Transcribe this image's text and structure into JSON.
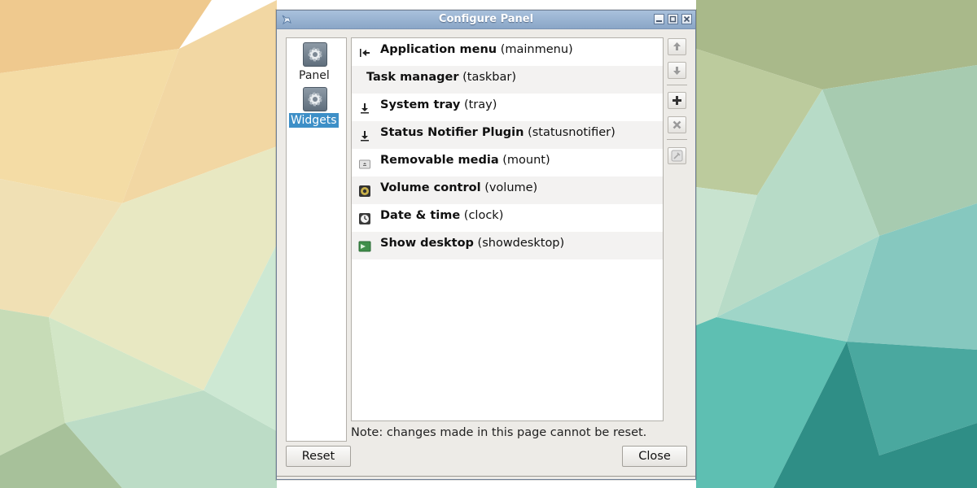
{
  "window": {
    "title": "Configure Panel",
    "controls": [
      "minimize-icon",
      "maximize-icon",
      "close-icon"
    ]
  },
  "sidebar": {
    "items": [
      {
        "label": "Panel",
        "icon": "panel-settings-icon",
        "selected": false
      },
      {
        "label": "Widgets",
        "icon": "widgets-settings-icon",
        "selected": true
      }
    ]
  },
  "widgets": [
    {
      "name": "Application menu",
      "id": "(mainmenu)",
      "icon": "app-menu-icon"
    },
    {
      "name": "Task manager",
      "id": "(taskbar)",
      "icon": ""
    },
    {
      "name": "System tray",
      "id": "(tray)",
      "icon": "download-arrow-icon"
    },
    {
      "name": "Status Notifier Plugin",
      "id": "(statusnotifier)",
      "icon": "download-arrow-icon"
    },
    {
      "name": "Removable media",
      "id": "(mount)",
      "icon": "drive-icon"
    },
    {
      "name": "Volume control",
      "id": "(volume)",
      "icon": "speaker-icon"
    },
    {
      "name": "Date & time",
      "id": "(clock)",
      "icon": "clock-icon"
    },
    {
      "name": "Show desktop",
      "id": "(showdesktop)",
      "icon": "desktop-icon"
    }
  ],
  "toolbar": [
    "move-up-icon",
    "move-down-icon",
    "add-icon",
    "remove-icon",
    "preferences-icon"
  ],
  "note": "Note: changes made in this page cannot be reset.",
  "buttons": {
    "reset": "Reset",
    "close": "Close"
  },
  "colors": {
    "selection": "#3d8fc7",
    "titlebar": "#9bb5d3"
  }
}
